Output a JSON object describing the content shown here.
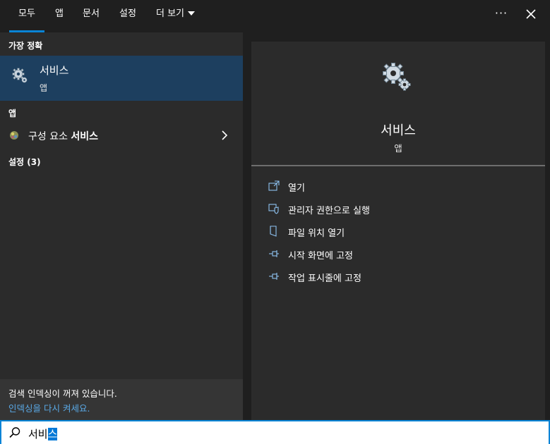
{
  "tabs": [
    {
      "label": "모두",
      "active": true
    },
    {
      "label": "앱"
    },
    {
      "label": "문서"
    },
    {
      "label": "설정"
    },
    {
      "label": "더 보기"
    }
  ],
  "topbar": {
    "more_options": "···"
  },
  "left": {
    "best_match_heading": "가장 정확",
    "best_match": {
      "title": "서비스",
      "subtitle": "앱",
      "icon": "gears-icon"
    },
    "apps_heading": "앱",
    "app_item": {
      "prefix": "구성 요소 ",
      "bold": "서비스",
      "icon": "component-services-icon"
    },
    "settings_heading": "설정 (3)",
    "notice_text": "검색 인덱싱이 꺼져 있습니다.",
    "notice_link": "인덱싱을 다시 켜세요."
  },
  "preview": {
    "title": "서비스",
    "subtitle": "앱",
    "actions": [
      {
        "label": "열기",
        "icon": "open-icon"
      },
      {
        "label": "관리자 권한으로 실행",
        "icon": "shield-icon"
      },
      {
        "label": "파일 위치 열기",
        "icon": "file-location-icon"
      },
      {
        "label": "시작 화면에 고정",
        "icon": "pin-icon"
      },
      {
        "label": "작업 표시줄에 고정",
        "icon": "pin-icon"
      }
    ]
  },
  "search": {
    "text_before": "서비",
    "text_selected": "스"
  },
  "colors": {
    "accent": "#0a84d6",
    "selection": "#1d3f5f",
    "link": "#5aa9e6"
  }
}
